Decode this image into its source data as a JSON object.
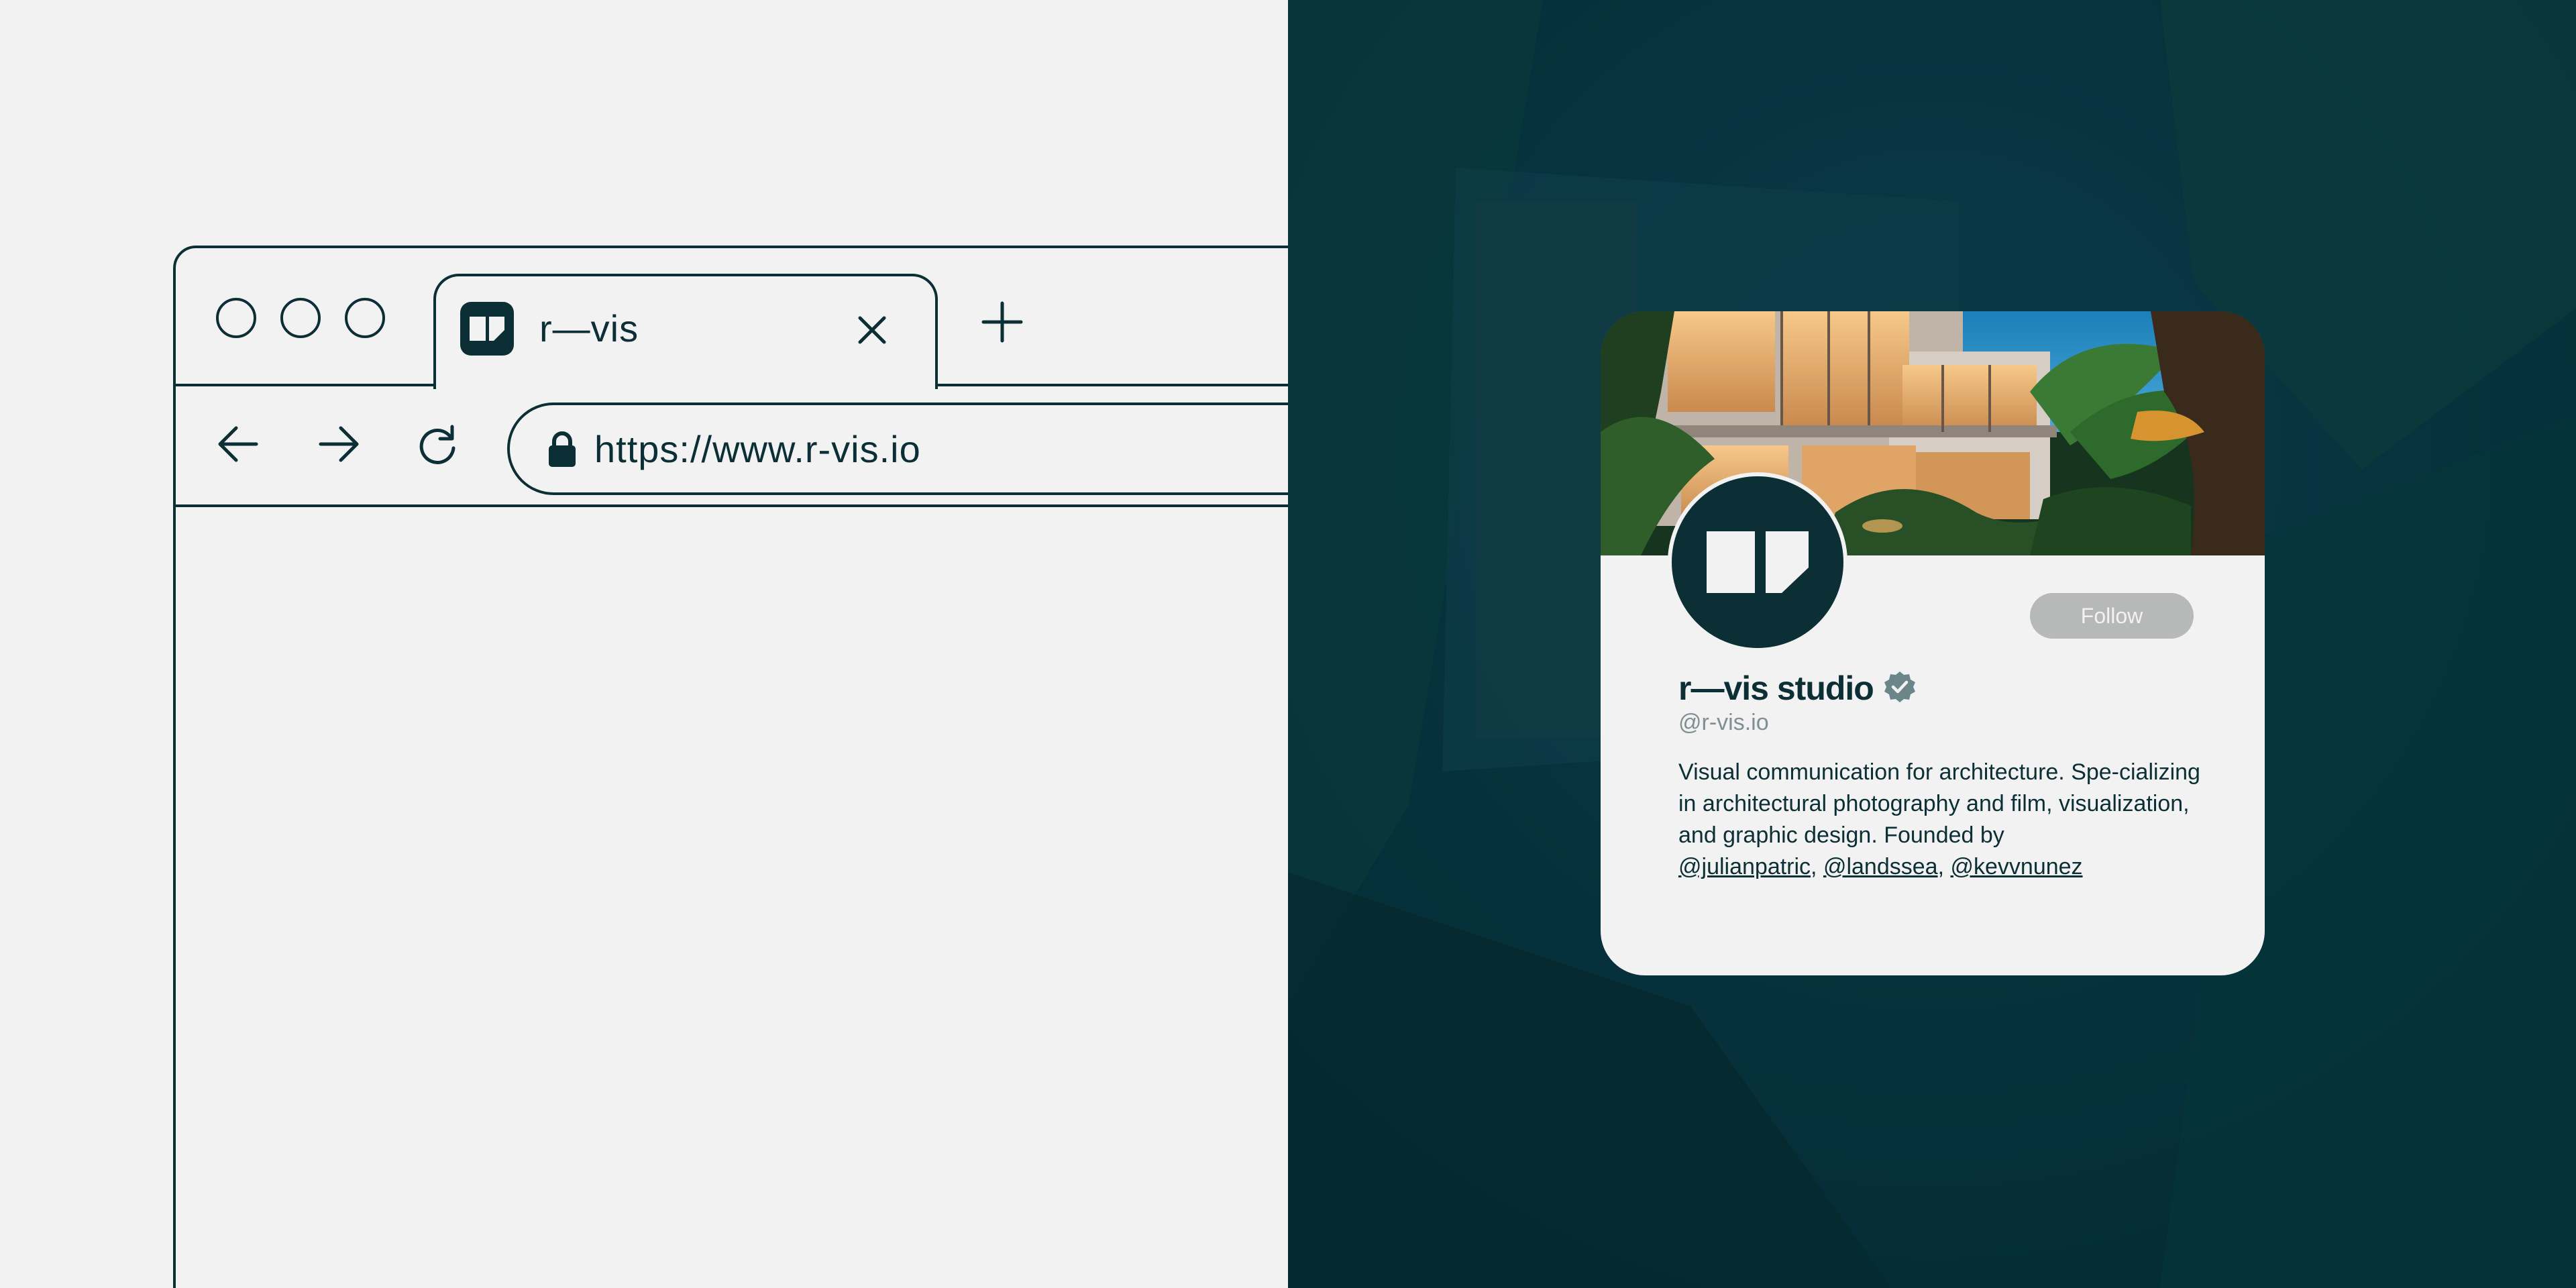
{
  "browser": {
    "tab": {
      "title": "r—vis",
      "favicon": "r-vis-logo-icon"
    },
    "icons": {
      "close": "close-icon",
      "new_tab": "plus-icon",
      "back": "arrow-left-icon",
      "forward": "arrow-right-icon",
      "reload": "reload-icon",
      "lock": "lock-icon"
    },
    "url": "https://www.r-vis.io"
  },
  "profile": {
    "name": "r—vis studio",
    "handle": "@r-vis.io",
    "follow_label": "Follow",
    "bio_text": "Visual communication for architecture. Spe-cializing in architectural photography and film, visualization, and graphic design. Founded by",
    "mentions": [
      "@julianpatric",
      "@landssea",
      "@kevvnunez"
    ],
    "separator": ", "
  },
  "colors": {
    "primary": "#0c2f36",
    "light_bg": "#f2f2f2",
    "dark_bg": "#052f3a",
    "follow_button": "#b7b9b9",
    "verified_badge": "#6c8589",
    "handle_text": "#7f8f92"
  }
}
